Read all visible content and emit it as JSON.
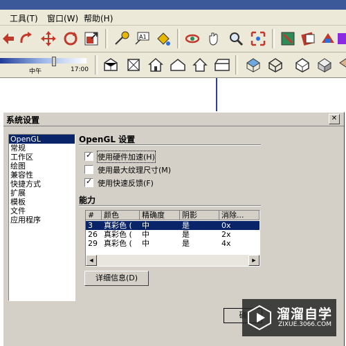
{
  "menu": {
    "tools": "工具(T)",
    "window": "窗口(W)",
    "help": "帮助(H)"
  },
  "shadow_bar": {
    "noon_label": "中午",
    "end_time": "17:00",
    "slider_level": 0.62
  },
  "dialog": {
    "title": "系统设置",
    "close_glyph": "✕",
    "nav_items": [
      "OpenGL",
      "常规",
      "工作区",
      "绘图",
      "兼容性",
      "快捷方式",
      "扩展",
      "模板",
      "文件",
      "应用程序"
    ],
    "selected_nav": 0,
    "section_title": "OpenGL 设置",
    "options": [
      {
        "label": "使用硬件加速(H)",
        "checked": true
      },
      {
        "label": "使用最大纹理尺寸(M)",
        "checked": false
      },
      {
        "label": "使用快速反馈(F)",
        "checked": true
      }
    ],
    "capabilities_title": "能力",
    "columns": [
      "#",
      "颜色",
      "精确度",
      "阴影",
      "消除..."
    ],
    "rows": [
      [
        "3",
        "真彩色 (",
        "中",
        "是",
        "0x"
      ],
      [
        "26",
        "真彩色 (",
        "中",
        "是",
        "2x"
      ],
      [
        "29",
        "真彩色 (",
        "中",
        "是",
        "4x"
      ]
    ],
    "selected_row": 0,
    "details_button": "详细信息(D)",
    "ok_button_partial": "确"
  },
  "watermark": {
    "brand": "溜溜自学",
    "url": "ZIXUE.3066.COM"
  },
  "colors": {
    "selection": "#0a246a",
    "dialog_bg": "#d4d0c8",
    "toolbar_bg": "#ece9d8"
  }
}
